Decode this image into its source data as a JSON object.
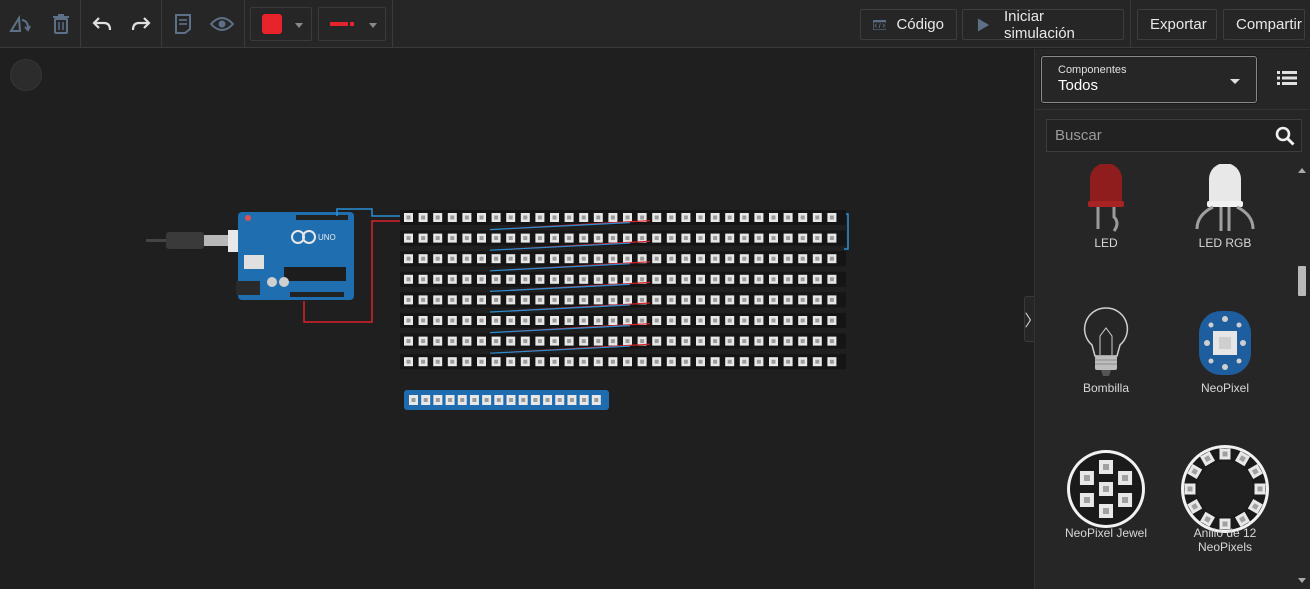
{
  "toolbar": {
    "icons": [
      "rotate-icon",
      "trash-icon",
      "undo-icon",
      "redo-icon",
      "notes-icon",
      "eye-icon"
    ],
    "fill_color": "#e8232b",
    "wire_color": "#e8232b",
    "code_label": "Código",
    "simulate_label": "Iniciar simulación",
    "export_label": "Exportar",
    "share_label": "Compartir"
  },
  "panel": {
    "toggle_glyph": "〉",
    "components_select": {
      "label": "Componentes",
      "value": "Todos"
    },
    "search": {
      "placeholder": "Buscar"
    },
    "components": [
      {
        "name": "LED",
        "icon": "led-icon"
      },
      {
        "name": "LED RGB",
        "icon": "led-rgb-icon"
      },
      {
        "name": "Bombilla",
        "icon": "light-bulb-icon"
      },
      {
        "name": "NeoPixel",
        "icon": "neopixel-icon"
      },
      {
        "name": "NeoPixel Jewel",
        "icon": "neopixel-jewel-icon"
      },
      {
        "name": "Anillo de 12 NeoPixels",
        "icon": "neopixel-ring-icon"
      }
    ]
  },
  "canvas": {
    "arduino_board_label": "UNO",
    "matrix_rows": 8,
    "matrix_cols": 30,
    "strip_pixels": 16,
    "colors": {
      "wire_red": "#d9242b",
      "wire_blue": "#2a8fd6",
      "board": "#1f6fb0",
      "strip": "#1e6bb0"
    }
  }
}
